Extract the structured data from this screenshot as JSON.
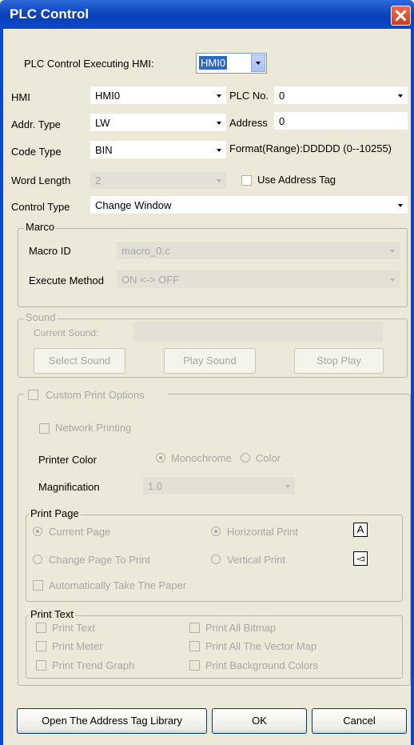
{
  "window": {
    "title": "PLC Control"
  },
  "executing": {
    "label": "PLC Control Executing HMI:",
    "value": "HMI0"
  },
  "hmi": {
    "label": "HMI",
    "value": "HMI0"
  },
  "plc_no": {
    "label": "PLC No.",
    "value": "0"
  },
  "addr_type": {
    "label": "Addr. Type",
    "value": "LW"
  },
  "address": {
    "label": "Address",
    "value": "0"
  },
  "code_type": {
    "label": "Code Type",
    "value": "BIN"
  },
  "format": {
    "text": "Format(Range):DDDDD (0--10255)"
  },
  "word_length": {
    "label": "Word Length",
    "value": "2"
  },
  "use_address_tag": {
    "label": "Use Address Tag"
  },
  "control_type": {
    "label": "Control Type",
    "value": "Change Window"
  },
  "marco": {
    "title": "Marco",
    "macro_id_label": "Macro ID",
    "macro_id_value": "macro_0.c",
    "execute_label": "Execute Method",
    "execute_value": "ON <-> OFF"
  },
  "sound": {
    "title": "Sound",
    "current_label": "Current Sound:",
    "select": "Select Sound",
    "play": "Play Sound",
    "stop": "Stop Play"
  },
  "print": {
    "custom": "Custom Print Options",
    "network": "Network Printing",
    "printer_color_label": "Printer Color",
    "monochrome": "Monochrome",
    "color": "Color",
    "magnification_label": "Magnification",
    "magnification_value": "1.0",
    "page": {
      "title": "Print Page",
      "current": "Current Page",
      "change": "Change Page To Print",
      "horizontal": "Horizontal Print",
      "vertical": "Vertical Print",
      "auto": "Automatically Take The Paper"
    },
    "text": {
      "title": "Print Text",
      "print_text": "Print Text",
      "print_meter": "Print Meter",
      "print_trend": "Print Trend Graph",
      "bitmap": "Print All Bitmap",
      "vector": "Print All The Vector Map",
      "background": "Print Background Colors"
    }
  },
  "footer": {
    "open_lib": "Open The Address Tag Library",
    "ok": "OK",
    "cancel": "Cancel"
  }
}
